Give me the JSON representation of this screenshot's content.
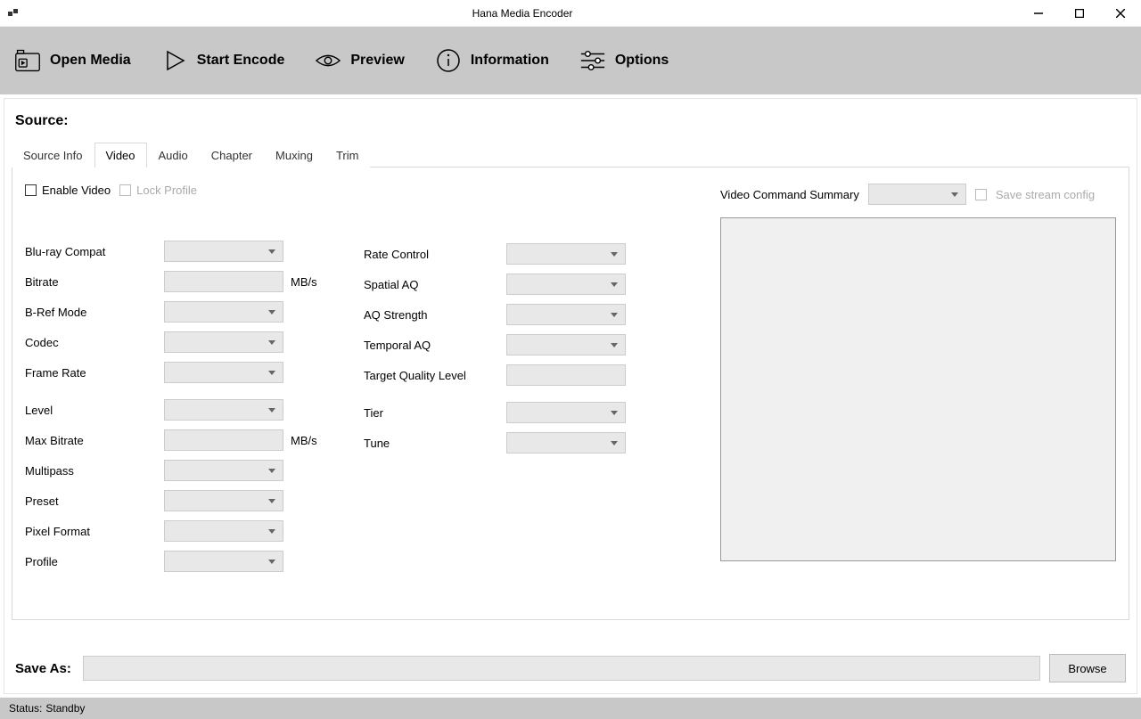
{
  "window": {
    "title": "Hana Media Encoder"
  },
  "toolbar": {
    "open_media": "Open Media",
    "start_encode": "Start Encode",
    "preview": "Preview",
    "information": "Information",
    "options": "Options"
  },
  "source_label": "Source:",
  "tabs": [
    "Source Info",
    "Video",
    "Audio",
    "Chapter",
    "Muxing",
    "Trim"
  ],
  "active_tab": "Video",
  "video": {
    "enable_label": "Enable Video",
    "lock_label": "Lock Profile",
    "left_fields": [
      {
        "label": "Blu-ray Compat",
        "type": "select"
      },
      {
        "label": "Bitrate",
        "type": "input",
        "unit": "MB/s"
      },
      {
        "label": "B-Ref Mode",
        "type": "select"
      },
      {
        "label": "Codec",
        "type": "select"
      },
      {
        "label": "Frame Rate",
        "type": "select"
      },
      {
        "label": "Level",
        "type": "select",
        "gap": true
      },
      {
        "label": "Max Bitrate",
        "type": "input",
        "unit": "MB/s"
      },
      {
        "label": "Multipass",
        "type": "select"
      },
      {
        "label": "Preset",
        "type": "select"
      },
      {
        "label": "Pixel Format",
        "type": "select"
      },
      {
        "label": "Profile",
        "type": "select"
      }
    ],
    "mid_fields": [
      {
        "label": "Rate Control",
        "type": "select"
      },
      {
        "label": "Spatial AQ",
        "type": "select"
      },
      {
        "label": "AQ Strength",
        "type": "select"
      },
      {
        "label": "Temporal AQ",
        "type": "select"
      },
      {
        "label": "Target Quality Level",
        "type": "input"
      },
      {
        "label": "Tier",
        "type": "select",
        "gap": true
      },
      {
        "label": "Tune",
        "type": "select"
      }
    ],
    "summary_label": "Video Command Summary",
    "save_stream_label": "Save stream config"
  },
  "save_as_label": "Save As:",
  "browse_label": "Browse",
  "status": {
    "label": "Status:",
    "value": "Standby"
  }
}
